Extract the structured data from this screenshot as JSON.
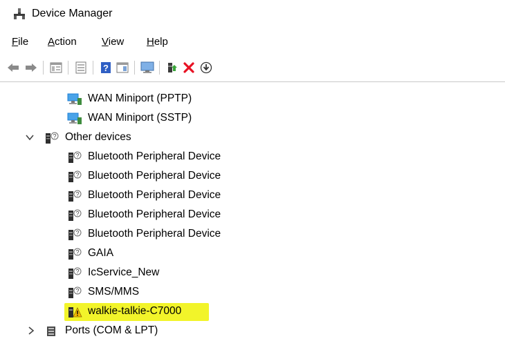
{
  "window": {
    "title": "Device Manager"
  },
  "menu": [
    {
      "label": "File",
      "key": "F",
      "rest": "ile"
    },
    {
      "label": "Action",
      "key": "A",
      "rest": "ction"
    },
    {
      "label": "View",
      "key": "V",
      "rest": "iew"
    },
    {
      "label": "Help",
      "key": "H",
      "rest": "elp"
    }
  ],
  "toolbar": {
    "buttons": [
      "back-icon",
      "forward-icon",
      "properties-view-icon",
      "console-tree-icon",
      "help-icon",
      "show-hide-icon",
      "monitor-icon",
      "update-driver-icon",
      "uninstall-icon",
      "download-icon"
    ]
  },
  "tree": {
    "wan_pptp": "WAN Miniport (PPTP)",
    "wan_sstp": "WAN Miniport (SSTP)",
    "other_devices": "Other devices",
    "bt1": "Bluetooth Peripheral Device",
    "bt2": "Bluetooth Peripheral Device",
    "bt3": "Bluetooth Peripheral Device",
    "bt4": "Bluetooth Peripheral Device",
    "bt5": "Bluetooth Peripheral Device",
    "gaia": "GAIA",
    "icservice": "IcService_New",
    "sms": "SMS/MMS",
    "walkie": "walkie-talkie-C7000",
    "ports": "Ports (COM & LPT)"
  },
  "colors": {
    "highlight": "#f2f42a",
    "uninstall_red": "#e81123",
    "network_blue": "#1e7fd6"
  }
}
